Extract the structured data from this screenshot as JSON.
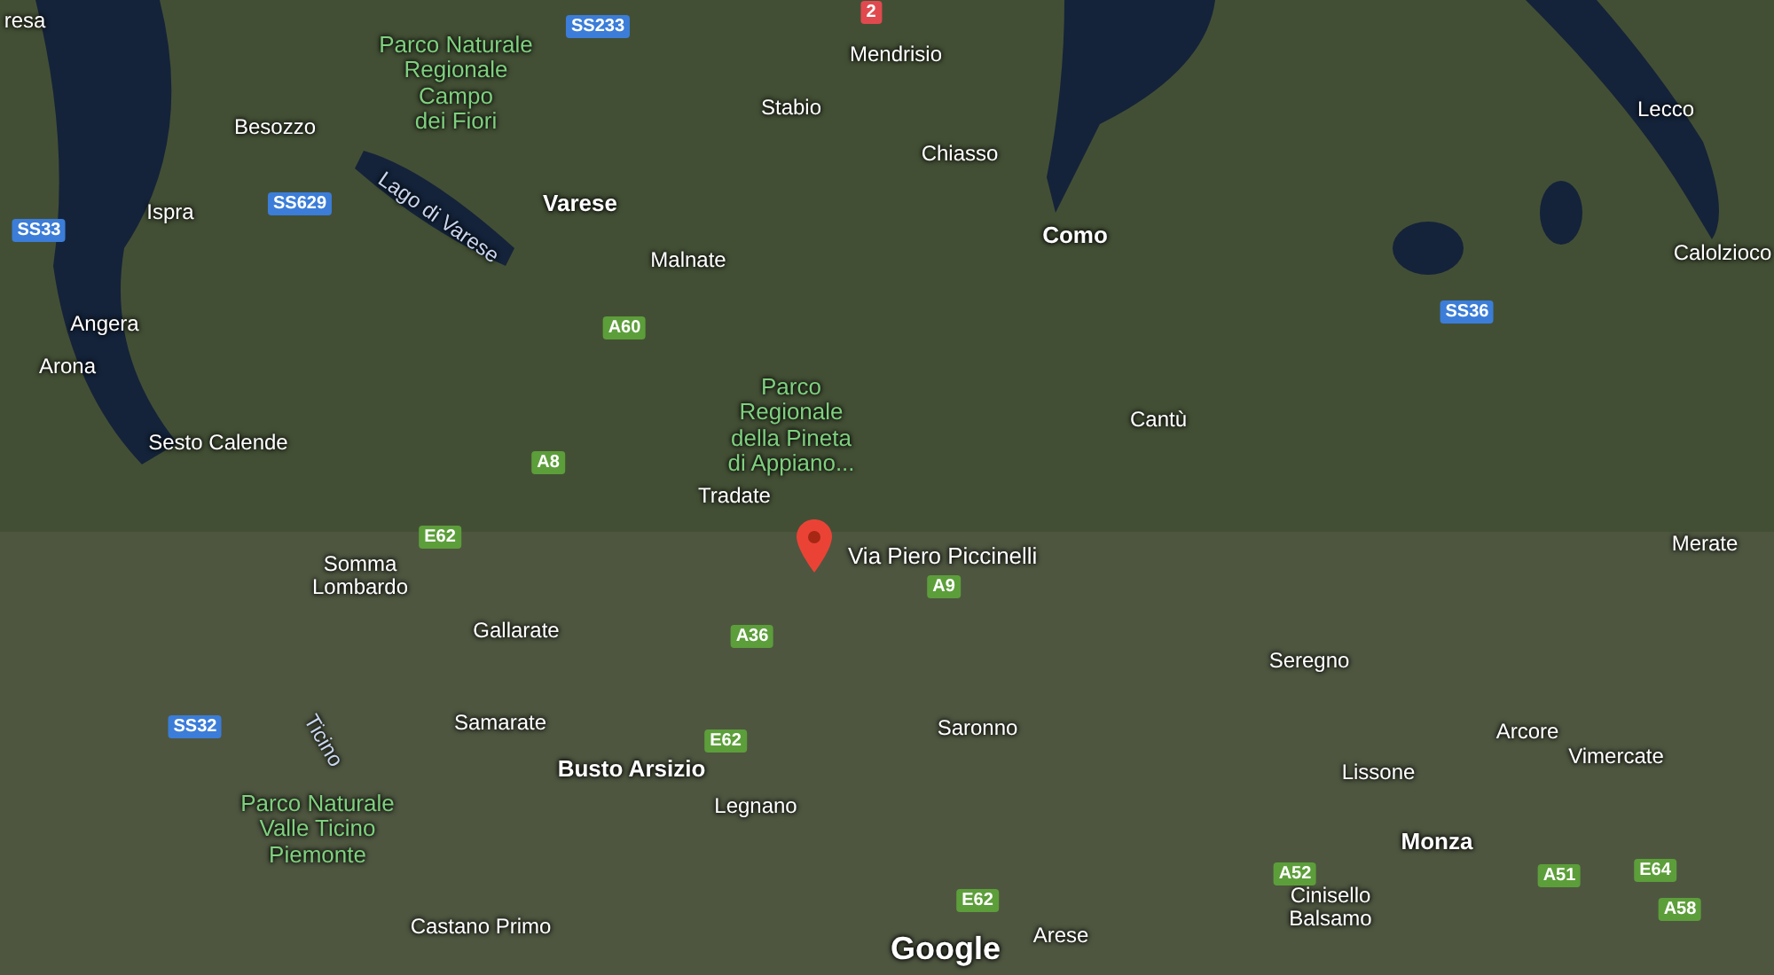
{
  "map": {
    "labels": [
      {
        "kind": "place",
        "text": "resa"
      },
      {
        "kind": "place",
        "text": "Besozzo"
      },
      {
        "kind": "park",
        "text": "Parco Naturale\nRegionale\nCampo\ndei Fiori"
      },
      {
        "kind": "place",
        "text": "Stabio"
      },
      {
        "kind": "place",
        "text": "Mendrisio"
      },
      {
        "kind": "place",
        "text": "Chiasso"
      },
      {
        "kind": "place",
        "text": "Lecco"
      },
      {
        "kind": "place",
        "text": "Ispra"
      },
      {
        "kind": "water",
        "text": "Lago di Varese"
      },
      {
        "kind": "city",
        "text": "Varese"
      },
      {
        "kind": "city",
        "text": "Como"
      },
      {
        "kind": "place",
        "text": "Calolzioco"
      },
      {
        "kind": "place",
        "text": "Malnate"
      },
      {
        "kind": "place",
        "text": "Angera"
      },
      {
        "kind": "place",
        "text": "Arona"
      },
      {
        "kind": "park",
        "text": "Parco\nRegionale\ndella Pineta\ndi Appiano..."
      },
      {
        "kind": "place",
        "text": "Cantù"
      },
      {
        "kind": "place",
        "text": "Sesto Calende"
      },
      {
        "kind": "place",
        "text": "Tradate"
      },
      {
        "kind": "place",
        "text": "Merate"
      },
      {
        "kind": "place",
        "text": "Somma\nLombardo"
      },
      {
        "kind": "place",
        "text": "Gallarate"
      },
      {
        "kind": "place",
        "text": "Seregno"
      },
      {
        "kind": "place",
        "text": "Samarate"
      },
      {
        "kind": "place",
        "text": "Saronno"
      },
      {
        "kind": "place",
        "text": "Arcore"
      },
      {
        "kind": "water",
        "text": "Ticino"
      },
      {
        "kind": "city",
        "text": "Busto Arsizio"
      },
      {
        "kind": "place",
        "text": "Lissone"
      },
      {
        "kind": "place",
        "text": "Vimercate"
      },
      {
        "kind": "place",
        "text": "Legnano"
      },
      {
        "kind": "park",
        "text": "Parco Naturale\nValle Ticino\nPiemonte"
      },
      {
        "kind": "city",
        "text": "Monza"
      },
      {
        "kind": "place",
        "text": "Cinisello\nBalsamo"
      },
      {
        "kind": "place",
        "text": "Castano Primo"
      },
      {
        "kind": "place",
        "text": "Arese"
      }
    ],
    "road_shields": [
      {
        "text": "SS233",
        "color": "#3b7dd8"
      },
      {
        "text": "2",
        "color": "#e04a4f"
      },
      {
        "text": "SS33",
        "color": "#3b7dd8"
      },
      {
        "text": "SS629",
        "color": "#3b7dd8"
      },
      {
        "text": "SS36",
        "color": "#3b7dd8"
      },
      {
        "text": "A60",
        "color": "#5c9e3a"
      },
      {
        "text": "A8",
        "color": "#5c9e3a"
      },
      {
        "text": "E62",
        "color": "#5c9e3a"
      },
      {
        "text": "A9",
        "color": "#5c9e3a"
      },
      {
        "text": "A36",
        "color": "#5c9e3a"
      },
      {
        "text": "SS32",
        "color": "#3b7dd8"
      },
      {
        "text": "E62",
        "color": "#5c9e3a"
      },
      {
        "text": "A52",
        "color": "#5c9e3a"
      },
      {
        "text": "A51",
        "color": "#5c9e3a"
      },
      {
        "text": "E64",
        "color": "#5c9e3a"
      },
      {
        "text": "A58",
        "color": "#5c9e3a"
      },
      {
        "text": "E62",
        "color": "#5c9e3a"
      }
    ],
    "marker": {
      "label": "Via Piero Piccinelli"
    },
    "attribution": "Google"
  }
}
